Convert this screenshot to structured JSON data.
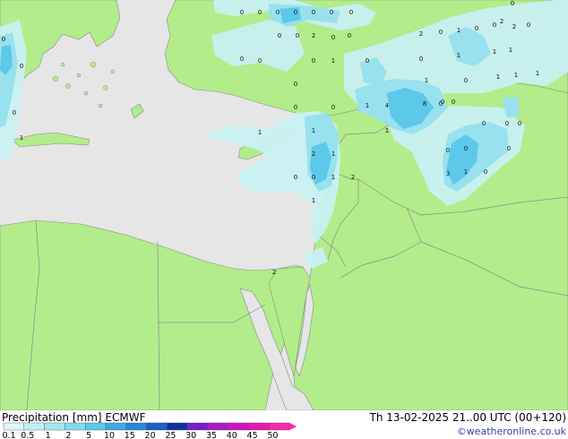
{
  "legend": {
    "title_prefix": "Precipitation",
    "unit": "[mm]",
    "model": "ECMWF",
    "scale_labels": [
      "0.1",
      "0.5",
      "1",
      "2",
      "5",
      "10",
      "15",
      "20",
      "25",
      "30",
      "35",
      "40",
      "45",
      "50"
    ],
    "scale_colors": [
      "#e0f7f8",
      "#c2f0f2",
      "#a3e8ee",
      "#7fdcea",
      "#5cc8ea",
      "#3aa8e4",
      "#2a86da",
      "#1a5fc8",
      "#10339c",
      "#7a1cd0",
      "#a81cc8",
      "#d012c0",
      "#e818b4",
      "#f82aa8"
    ]
  },
  "valid_time": "Th 13-02-2025 21..00 UTC (00+120)",
  "credit": "©weatheronline.co.uk",
  "colors": {
    "land": "#b3ec8a",
    "sea": "#e6e6e6",
    "border": "#8a8a8a",
    "precip_light": "#c9f1f3",
    "precip_mid": "#98e1ee",
    "precip_heavy": "#5cc8ea",
    "label": "#111111"
  },
  "map_labels": [
    "0",
    "0",
    "0",
    "0",
    "0",
    "0",
    "0",
    "0",
    "0",
    "0",
    "2",
    "0",
    "0",
    "0",
    "0",
    "0",
    "2",
    "0",
    "1",
    "0",
    "0",
    "2",
    "0",
    "0",
    "0",
    "1",
    "0",
    "1",
    "1",
    "1",
    "1",
    "1",
    "1",
    "0",
    "1",
    "0",
    "0",
    "1",
    "1",
    "4",
    "8",
    "0",
    "0",
    "0",
    "1",
    "2",
    "1",
    "0",
    "1",
    "1",
    "2",
    "0",
    "2",
    "1",
    "0",
    "3",
    "0",
    "0",
    "1",
    "0",
    "0",
    "0",
    "0",
    "2",
    "0",
    "0",
    "0",
    "1"
  ]
}
